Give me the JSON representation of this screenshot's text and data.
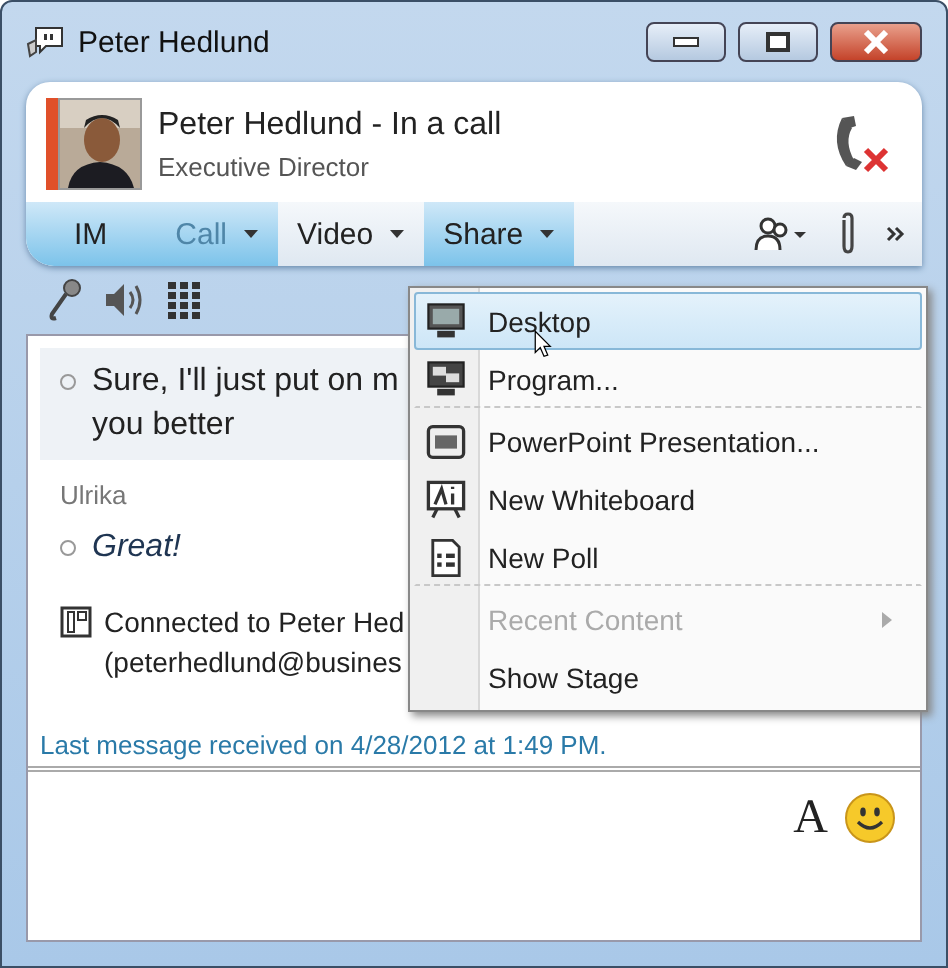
{
  "window": {
    "title": "Peter Hedlund"
  },
  "contact": {
    "name_status": "Peter Hedlund - In a call",
    "title": "Executive Director"
  },
  "toolbar": {
    "buttons": [
      {
        "label": "IM",
        "active": true,
        "disabled": false,
        "dropdown": false
      },
      {
        "label": "Call",
        "active": true,
        "disabled": true,
        "dropdown": true
      },
      {
        "label": "Video",
        "active": false,
        "disabled": false,
        "dropdown": true
      },
      {
        "label": "Share",
        "active": true,
        "disabled": false,
        "dropdown": true
      }
    ]
  },
  "conversation": [
    {
      "kind": "message",
      "lines": [
        "Sure, I'll just put on m",
        "you better"
      ],
      "italic": false,
      "shaded": true
    },
    {
      "kind": "sender",
      "text": "Ulrika"
    },
    {
      "kind": "message",
      "lines": [
        "Great!"
      ],
      "italic": true,
      "shaded": false
    },
    {
      "kind": "notice",
      "lines": [
        "Connected to Peter Hed",
        "(peterhedlund@busines"
      ]
    }
  ],
  "last_message": "Last message received on 4/28/2012 at 1:49 PM.",
  "share_menu": {
    "items": [
      {
        "label": "Desktop",
        "selected": true,
        "disabled": false,
        "submenu": false,
        "separator_after": false,
        "kind": "monitor"
      },
      {
        "label": "Program...",
        "selected": false,
        "disabled": false,
        "submenu": false,
        "separator_after": true,
        "kind": "program"
      },
      {
        "label": "PowerPoint Presentation...",
        "selected": false,
        "disabled": false,
        "submenu": false,
        "separator_after": false,
        "kind": "slides"
      },
      {
        "label": "New Whiteboard",
        "selected": false,
        "disabled": false,
        "submenu": false,
        "separator_after": false,
        "kind": "whiteboard"
      },
      {
        "label": "New Poll",
        "selected": false,
        "disabled": false,
        "submenu": false,
        "separator_after": true,
        "kind": "poll"
      },
      {
        "label": "Recent Content",
        "selected": false,
        "disabled": true,
        "submenu": true,
        "separator_after": false,
        "kind": "text"
      },
      {
        "label": "Show Stage",
        "selected": false,
        "disabled": false,
        "submenu": false,
        "separator_after": false,
        "kind": "text"
      }
    ]
  },
  "compose": {
    "font_button": "A"
  }
}
